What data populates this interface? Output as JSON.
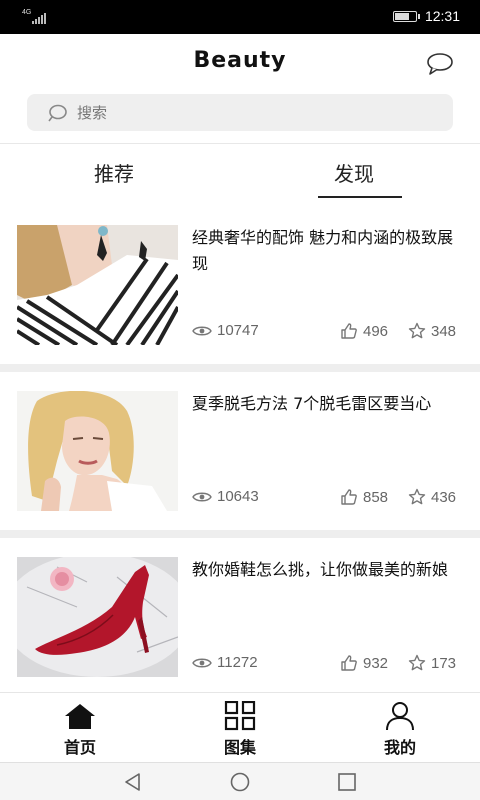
{
  "status_bar": {
    "network": "4G",
    "time": "12:31",
    "battery_level": 0.7
  },
  "header": {
    "title": "Beauty",
    "chat_icon": "chat-bubble-icon"
  },
  "search": {
    "placeholder": "搜索",
    "icon": "search-icon"
  },
  "tabs": [
    {
      "label": "推荐",
      "active": false
    },
    {
      "label": "发现",
      "active": true
    }
  ],
  "articles": [
    {
      "title": "经典奢华的配饰 魅力和内涵的极致展现",
      "views": "10747",
      "likes": "496",
      "favorites": "348",
      "image": "woman-earring-photo"
    },
    {
      "title": "夏季脱毛方法 7个脱毛雷区要当心",
      "views": "10643",
      "likes": "858",
      "favorites": "436",
      "image": "blonde-woman-photo"
    },
    {
      "title": "教你婚鞋怎么挑，让你做最美的新娘",
      "views": "11272",
      "likes": "932",
      "favorites": "173",
      "image": "red-heel-shoe-photo"
    }
  ],
  "bottom_nav": [
    {
      "label": "首页",
      "icon": "home-icon",
      "active": true
    },
    {
      "label": "图集",
      "icon": "grid-icon",
      "active": false
    },
    {
      "label": "我的",
      "icon": "user-icon",
      "active": false
    }
  ],
  "system_nav": [
    "back-icon",
    "home-circle-icon",
    "recents-icon"
  ]
}
